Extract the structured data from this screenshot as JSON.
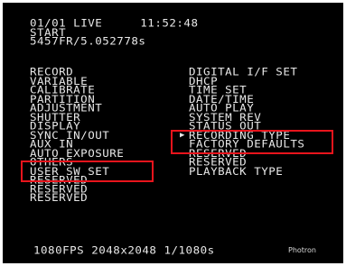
{
  "status": {
    "clip_counter": "01/01",
    "mode": "LIVE",
    "time": "11:52:48",
    "trigger_state": "START",
    "frame_info": "5457FR/5.052778s"
  },
  "menu": {
    "left_items": [
      "RECORD",
      "VARIABLE",
      "CALIBRATE",
      "PARTITION",
      "ADJUSTMENT",
      "SHUTTER",
      "DISPLAY",
      "SYNC IN/OUT",
      "AUX IN",
      "AUTO EXPOSURE",
      "OTHERS",
      "USER SW SET",
      "RESERVED",
      "RESERVED",
      "RESERVED"
    ],
    "right_items": [
      "DIGITAL I/F SET",
      "DHCP",
      "TIME SET",
      "DATE/TIME",
      "AUTO PLAY",
      "SYSTEM REV",
      "STATUS OUT",
      "RECORDING TYPE",
      "FACTORY DEFAULTS",
      "RESERVED",
      "RESERVED",
      "PLAYBACK TYPE"
    ],
    "cursor_glyph": "▶"
  },
  "footer": {
    "frame_rate": "1080FPS",
    "resolution": "2048x2048",
    "shutter": "1/1080s",
    "brand": "Photron"
  },
  "colors": {
    "background": "#000000",
    "text": "#e8e8e8",
    "highlight_box": "#e8141c"
  }
}
